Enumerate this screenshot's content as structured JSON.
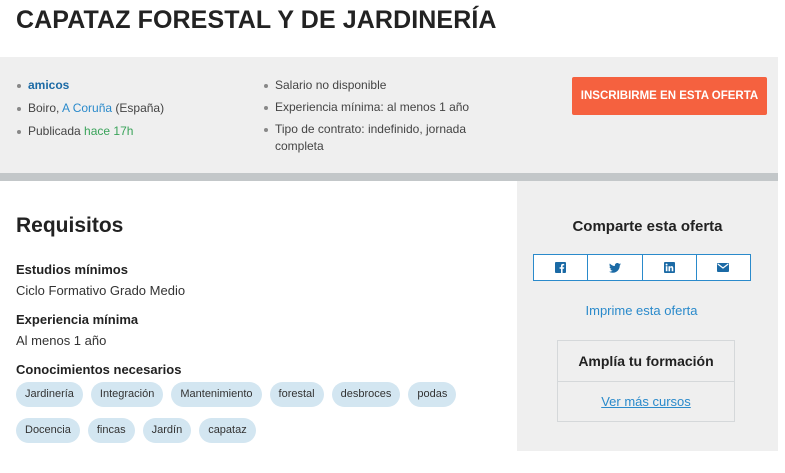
{
  "job": {
    "title": "CAPATAZ FORESTAL Y DE JARDINERÍA"
  },
  "summary": {
    "company": "amicos",
    "location_city": "Boiro, ",
    "location_province": "A Coruña",
    "location_country": " (España)",
    "published_label": "Publicada ",
    "published_ago": "hace 17h",
    "salary": "Salario no disponible",
    "experience": "Experiencia mínima: al menos 1 año",
    "contract": "Tipo de contrato: indefinido, jornada completa",
    "apply_button": "INSCRIBIRME EN ESTA OFERTA"
  },
  "requirements": {
    "title": "Requisitos",
    "studies_label": "Estudios mínimos",
    "studies_value": "Ciclo Formativo Grado Medio",
    "experience_label": "Experiencia mínima",
    "experience_value": "Al menos 1 año",
    "knowledge_label": "Conocimientos necesarios",
    "tags_row1": [
      "Jardinería",
      "Integración",
      "Mantenimiento",
      "forestal",
      "desbroces",
      "podas"
    ],
    "tags_row2": [
      "Docencia",
      "fincas",
      "Jardín",
      "capataz"
    ]
  },
  "sidebar": {
    "share_title": "Comparte esta oferta",
    "share_icons": [
      "facebook-icon",
      "twitter-icon",
      "linkedin-icon",
      "email-icon"
    ],
    "print_link": "Imprime esta oferta",
    "training_title": "Amplía tu formación",
    "training_link": "Ver más cursos"
  },
  "colors": {
    "accent_orange": "#f5613f",
    "link_blue": "#2a8acb",
    "tag_bg": "#d3e6f1",
    "panel_bg": "#efefef"
  }
}
